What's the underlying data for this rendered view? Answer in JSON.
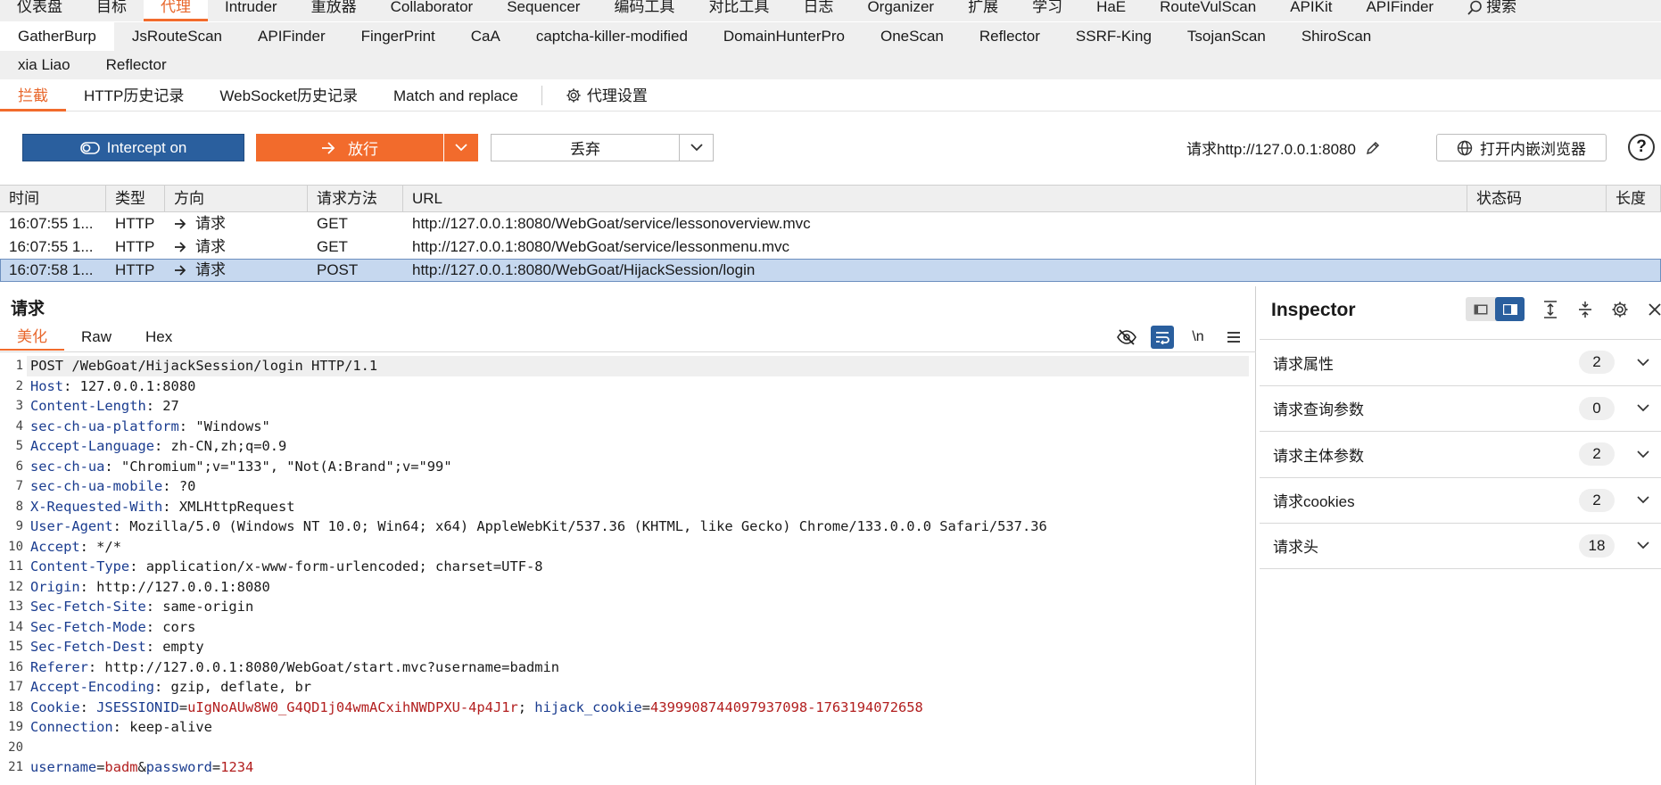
{
  "nav_main": [
    "仪表盘",
    "目标",
    "代理",
    "Intruder",
    "重放器",
    "Collaborator",
    "Sequencer",
    "编码工具",
    "对比工具",
    "日志",
    "Organizer",
    "扩展",
    "学习",
    "HaE",
    "RouteVulScan",
    "APIKit",
    "APIFinder"
  ],
  "nav_search_label": "搜索",
  "nav_ext_row1": [
    "GatherBurp",
    "JsRouteScan",
    "APIFinder",
    "FingerPrint",
    "CaA",
    "captcha-killer-modified",
    "DomainHunterPro",
    "OneScan",
    "Reflector",
    "SSRF-King",
    "TsojanScan",
    "ShiroScan"
  ],
  "nav_ext_row2": [
    "xia Liao",
    "Reflector"
  ],
  "proxy_tabs": [
    "拦截",
    "HTTP历史记录",
    "WebSocket历史记录",
    "Match and replace"
  ],
  "proxy_settings_label": "代理设置",
  "controls": {
    "intercept_label": "Intercept on",
    "forward_label": "放行",
    "drop_label": "丢弃",
    "request_target": "请求http://127.0.0.1:8080",
    "open_browser_label": "打开内嵌浏览器",
    "help_symbol": "?"
  },
  "history": {
    "columns": [
      "时间",
      "类型",
      "方向",
      "请求方法",
      "URL",
      "状态码",
      "长度"
    ],
    "rows": [
      {
        "time": "16:07:55 1...",
        "type": "HTTP",
        "direction": "请求",
        "method": "GET",
        "url": "http://127.0.0.1:8080/WebGoat/service/lessonoverview.mvc",
        "selected": false
      },
      {
        "time": "16:07:55 1...",
        "type": "HTTP",
        "direction": "请求",
        "method": "GET",
        "url": "http://127.0.0.1:8080/WebGoat/service/lessonmenu.mvc",
        "selected": false
      },
      {
        "time": "16:07:58 1...",
        "type": "HTTP",
        "direction": "请求",
        "method": "POST",
        "url": "http://127.0.0.1:8080/WebGoat/HijackSession/login",
        "selected": true
      }
    ]
  },
  "request": {
    "title": "请求",
    "subtabs": [
      "美化",
      "Raw",
      "Hex"
    ],
    "newline_symbol": "\\n",
    "request_line": "POST /WebGoat/HijackSession/login HTTP/1.1",
    "headers": [
      {
        "name": "Host",
        "value": "127.0.0.1:8080"
      },
      {
        "name": "Content-Length",
        "value": "27"
      },
      {
        "name": "sec-ch-ua-platform",
        "value": "\"Windows\""
      },
      {
        "name": "Accept-Language",
        "value": "zh-CN,zh;q=0.9"
      },
      {
        "name": "sec-ch-ua",
        "value": "\"Chromium\";v=\"133\", \"Not(A:Brand\";v=\"99\""
      },
      {
        "name": "sec-ch-ua-mobile",
        "value": "?0"
      },
      {
        "name": "X-Requested-With",
        "value": "XMLHttpRequest"
      },
      {
        "name": "User-Agent",
        "value": "Mozilla/5.0 (Windows NT 10.0; Win64; x64) AppleWebKit/537.36 (KHTML, like Gecko) Chrome/133.0.0.0 Safari/537.36"
      },
      {
        "name": "Accept",
        "value": "*/*"
      },
      {
        "name": "Content-Type",
        "value": "application/x-www-form-urlencoded; charset=UTF-8"
      },
      {
        "name": "Origin",
        "value": "http://127.0.0.1:8080"
      },
      {
        "name": "Sec-Fetch-Site",
        "value": "same-origin"
      },
      {
        "name": "Sec-Fetch-Mode",
        "value": "cors"
      },
      {
        "name": "Sec-Fetch-Dest",
        "value": "empty"
      },
      {
        "name": "Referer",
        "value": "http://127.0.0.1:8080/WebGoat/start.mvc?username=badmin"
      },
      {
        "name": "Accept-Encoding",
        "value": "gzip, deflate, br"
      }
    ],
    "cookie_header_name": "Cookie",
    "cookies": [
      {
        "name": "JSESSIONID",
        "value": "uIgNoAUw8W0_G4QD1j04wmACxihNWDPXU-4p4J1r"
      },
      {
        "name": "hijack_cookie",
        "value": "4399908744097937098-1763194072658"
      }
    ],
    "connection_header": {
      "name": "Connection",
      "value": "keep-alive"
    },
    "body_params": [
      {
        "name": "username",
        "value": "badm"
      },
      {
        "name": "password",
        "value": "1234"
      }
    ]
  },
  "inspector": {
    "title": "Inspector",
    "sections": [
      {
        "label": "请求属性",
        "count": "2"
      },
      {
        "label": "请求查询参数",
        "count": "0"
      },
      {
        "label": "请求主体参数",
        "count": "2"
      },
      {
        "label": "请求cookies",
        "count": "2"
      },
      {
        "label": "请求头",
        "count": "18"
      }
    ]
  },
  "colors": {
    "accent_orange": "#f26b2c",
    "intercept_blue": "#2a5f9e",
    "header_key_blue": "#1a3c8f",
    "param_value_red": "#b21e1e",
    "selected_row": "#c6d8ef"
  }
}
